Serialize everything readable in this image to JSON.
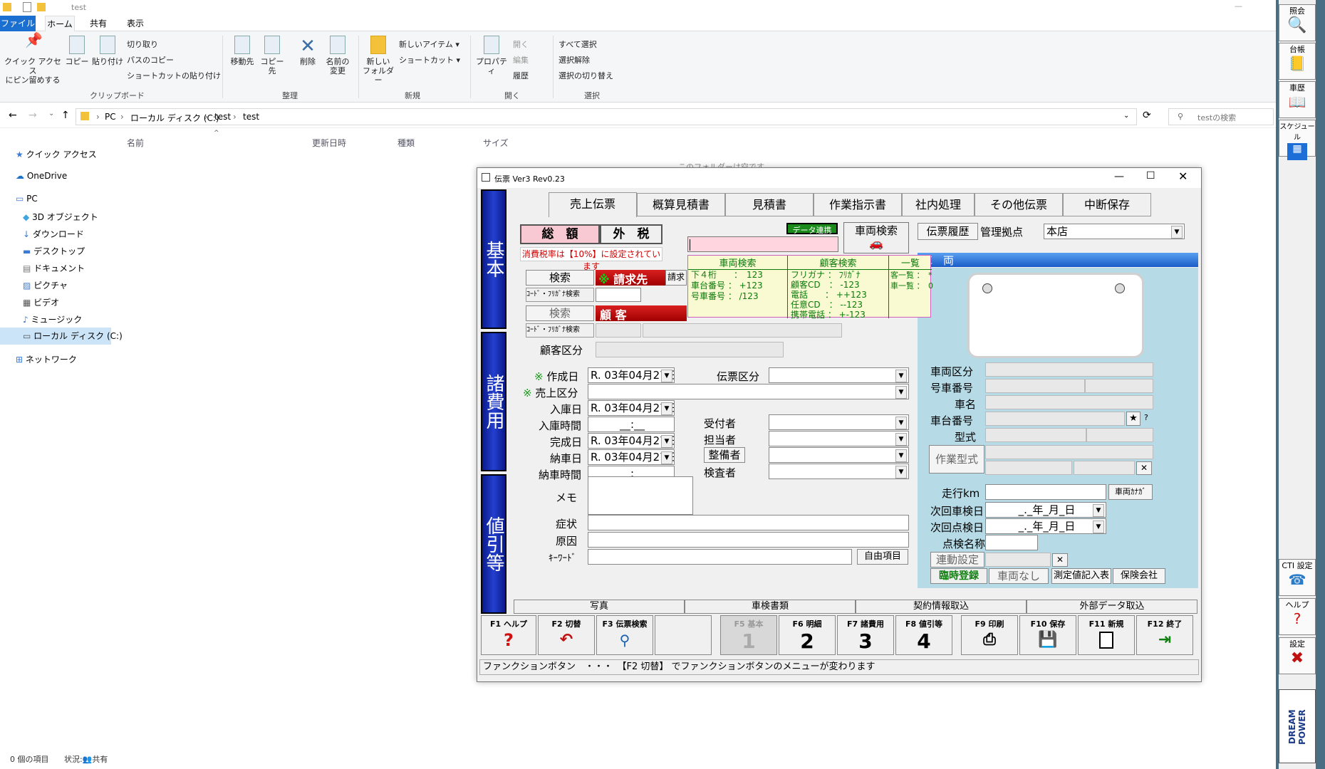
{
  "explorer": {
    "title": "test",
    "menu_tabs": [
      "ファイル",
      "ホーム",
      "共有",
      "表示"
    ],
    "ribbon": {
      "pin": "クイック アクセス\nにピン留めする",
      "copy": "コピー",
      "paste": "貼り付け",
      "cut": "切り取り",
      "copy_path": "パスのコピー",
      "paste_shortcut": "ショートカットの貼り付け",
      "group_clipboard": "クリップボード",
      "move_to": "移動先",
      "copy_to": "コピー先",
      "delete": "削除",
      "rename": "名前の\n変更",
      "group_organize": "整理",
      "new_folder": "新しい\nフォルダー",
      "new_item": "新しいアイテム",
      "shortcut": "ショートカット",
      "group_new": "新規",
      "properties": "プロパティ",
      "open": "開く",
      "edit": "編集",
      "history": "履歴",
      "group_open": "開く",
      "select_all": "すべて選択",
      "select_none": "選択解除",
      "invert": "選択の切り替え",
      "group_select": "選択"
    },
    "address": {
      "pc": "PC",
      "disk": "ローカル ディスク (C:)",
      "folder1": "test",
      "folder2": "test",
      "search_placeholder": "testの検索"
    },
    "nav": [
      "クイック アクセス",
      "OneDrive",
      "PC",
      "3D オブジェクト",
      "ダウンロード",
      "デスクトップ",
      "ドキュメント",
      "ピクチャ",
      "ビデオ",
      "ミュージック",
      "ローカル ディスク (C:)",
      "ネットワーク"
    ],
    "columns": [
      "名前",
      "更新日時",
      "種類",
      "サイズ"
    ],
    "empty_text": "このフォルダーは空です。",
    "status": {
      "count": "0 個の項目",
      "state": "状況:",
      "shared": "共有"
    }
  },
  "sidebar": {
    "items": [
      "照会",
      "台帳",
      "車歴",
      "スケジュール",
      "CTI 設定",
      "ヘルプ",
      "設定"
    ],
    "brand": "DREAM POWER"
  },
  "dialog": {
    "title": "伝票 Ver3 Rev0.23",
    "vtabs": [
      "基本",
      "諸費用",
      "値引等"
    ],
    "tabs": [
      "売上伝票",
      "概算見積書",
      "見積書",
      "作業指示書",
      "社内処理",
      "その他伝票",
      "中断保存"
    ],
    "total": "総　額",
    "tax": "外　税",
    "tax_note": "消費税率は【10%】に設定されています",
    "data_link": "データ連携",
    "vehicle_search": "車両検索",
    "slip_history": "伝票履歴",
    "base_label": "管理拠点",
    "base_value": "本店",
    "search_btn": "検索",
    "billing": "請求先",
    "billing2": "請求",
    "code_search": "ｺｰﾄﾞ・ﾌﾘｶﾞﾅ検索",
    "search_btn2": "検索",
    "customer": "顧 客",
    "customer_type": "顧客区分",
    "vehicle_header": "車　両",
    "popup": {
      "col1_title": "車両検索",
      "col1": [
        "下４桁　　：　123",
        "車台番号 ： +123",
        "号車番号 ： /123"
      ],
      "col2_title": "顧客検索",
      "col2": [
        "フリガナ ： ﾌﾘｶﾞﾅ",
        "顧客CD　： -123",
        "電話　　： ++123",
        "任意CD　： --123",
        "携帯電話 ： +-123"
      ],
      "col3_title": "一覧",
      "col3": [
        "客一覧 ：　*",
        "車一覧 ：　0"
      ]
    },
    "form": {
      "created": "作成日",
      "created_val": "R. 03年04月27日",
      "slip_type": "伝票区分",
      "sales_type": "売上区分",
      "entry_date": "入庫日",
      "entry_val": "R. 03年04月27日",
      "entry_time": "入庫時間",
      "time_val": "__:__",
      "done_date": "完成日",
      "done_val": "R. 03年04月27日",
      "delivery": "納車日",
      "delivery_val": "R. 03年04月27日",
      "delivery_time": "納車時間",
      "delivery_time_val": "__:__",
      "receiver": "受付者",
      "person": "担当者",
      "mechanic": "整備者",
      "inspector": "検査者",
      "memo": "メモ",
      "symptom": "症状",
      "cause": "原因",
      "keyword": "ｷｰﾜｰﾄﾞ",
      "free_item": "自由項目",
      "mark": "※"
    },
    "vehicle": {
      "type": "車両区分",
      "number": "号車番号",
      "name": "車名",
      "chassis": "車台番号",
      "model": "型式",
      "work_model": "作業型式",
      "mileage": "走行km",
      "vehicle_kana": "車両ｶﾅｶﾞ",
      "next_inspect": "次回車検日",
      "next_check": "次回点検日",
      "date_blank": "_._年_月_日",
      "check_name": "点検名称",
      "linked": "連動設定",
      "temp_reg": "臨時登録",
      "no_vehicle": "車両なし",
      "measure": "測定値記入表",
      "insurance": "保険会社",
      "star": "★",
      "q": "?"
    },
    "bottom_tabs": [
      "写真",
      "車検書類",
      "契約情報取込",
      "外部データ取込"
    ],
    "fkeys": [
      {
        "label": "F1 ヘルプ",
        "num": ""
      },
      {
        "label": "F2 切替",
        "num": ""
      },
      {
        "label": "F3 伝票検索",
        "num": ""
      },
      {
        "label": "",
        "num": ""
      },
      {
        "label": "F5 基本",
        "num": "1"
      },
      {
        "label": "F6 明細",
        "num": "2"
      },
      {
        "label": "F7 諸費用",
        "num": "3"
      },
      {
        "label": "F8 値引等",
        "num": "4"
      },
      {
        "label": "F9 印刷",
        "num": ""
      },
      {
        "label": "F10 保存",
        "num": ""
      },
      {
        "label": "F11 新規",
        "num": ""
      },
      {
        "label": "F12 終了",
        "num": ""
      }
    ],
    "status": "ファンクションボタン　・・・　【F2 切替】 でファンクションボタンのメニューが変わります"
  }
}
